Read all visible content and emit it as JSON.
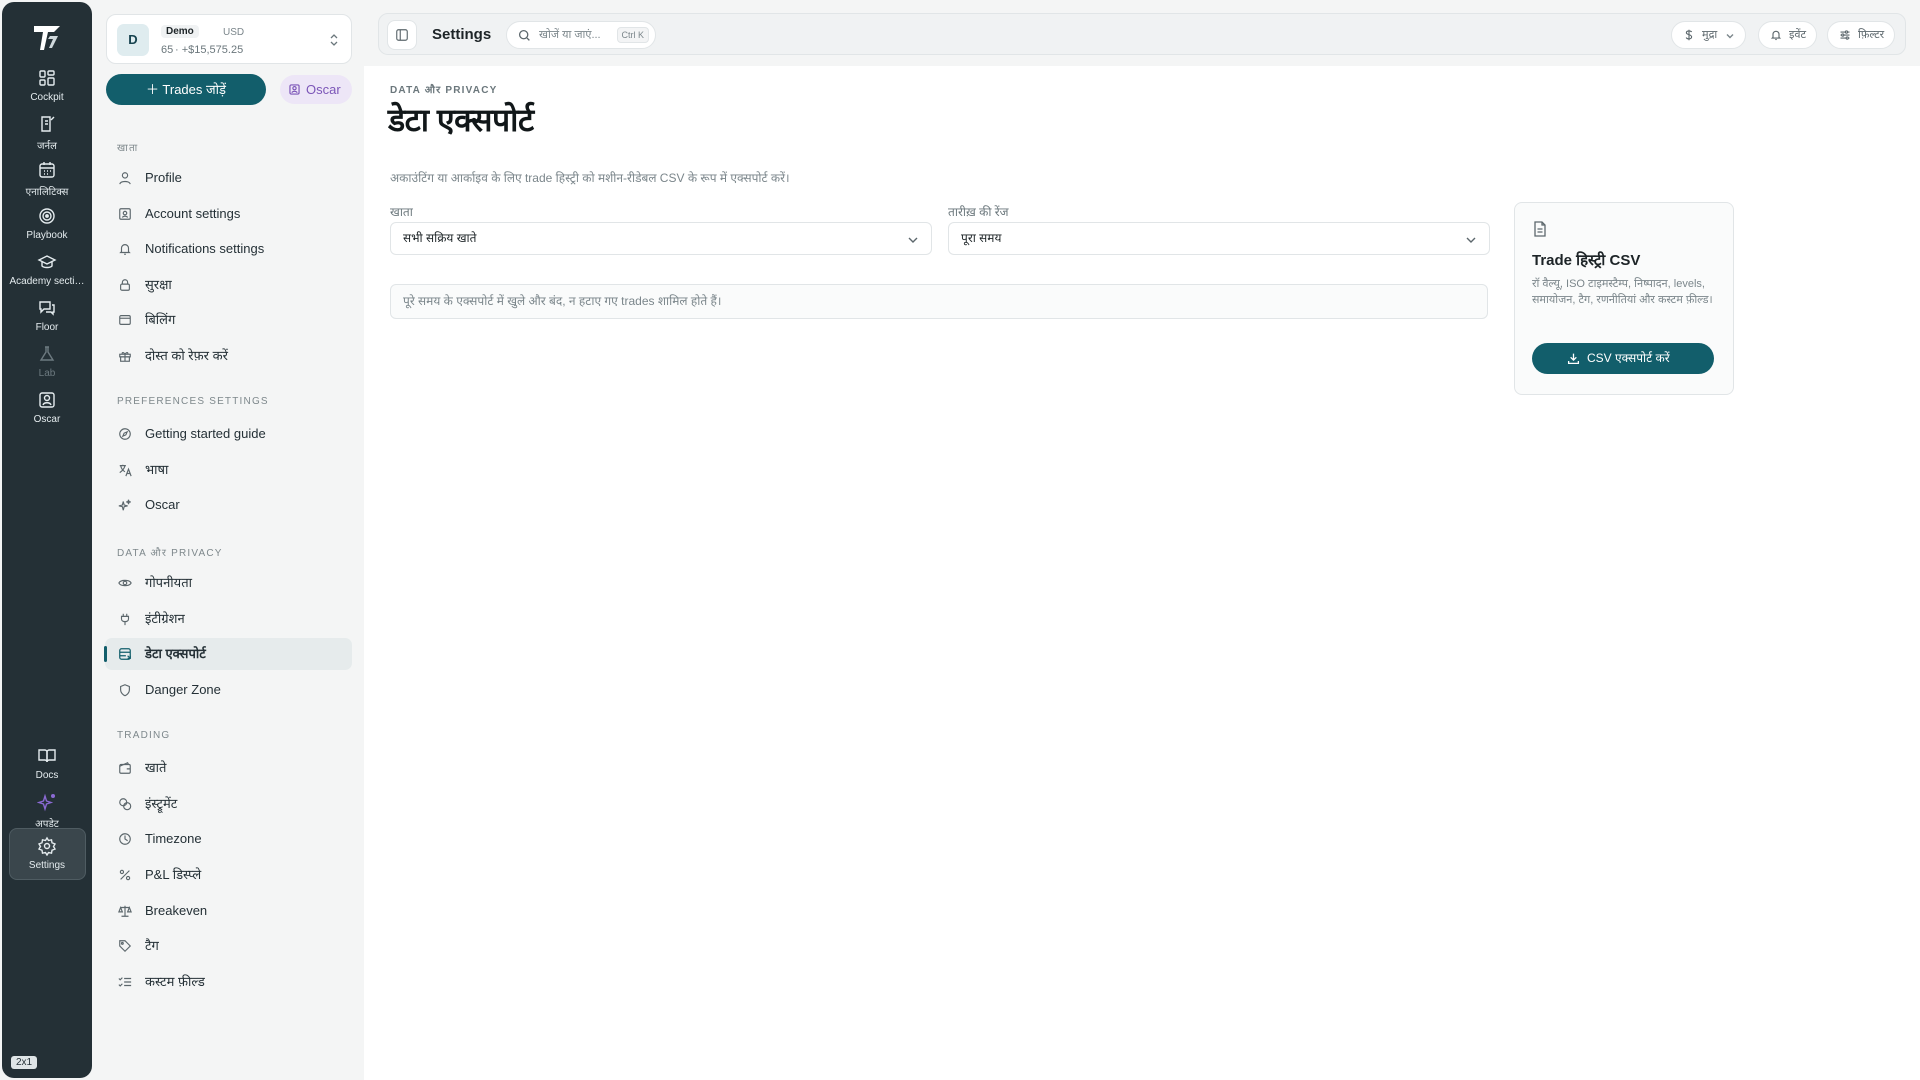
{
  "rail": {
    "items": [
      {
        "label": "Cockpit",
        "icon": "grid-icon"
      },
      {
        "label": "जर्नल",
        "icon": "journal-icon"
      },
      {
        "label": "एनालिटिक्स",
        "icon": "calendar-icon"
      },
      {
        "label": "Playbook",
        "icon": "target-icon"
      },
      {
        "label": "Academy secti…",
        "icon": "graduation-cap-icon"
      },
      {
        "label": "Floor",
        "icon": "chat-icon"
      },
      {
        "label": "Lab",
        "icon": "flask-icon"
      },
      {
        "label": "Oscar",
        "icon": "oscar-icon"
      }
    ],
    "bottom": [
      {
        "label": "Docs",
        "icon": "book-icon"
      },
      {
        "label": "अपडेट",
        "icon": "sparkles-icon"
      },
      {
        "label": "Settings",
        "icon": "gear-icon"
      }
    ],
    "badge": "2x1"
  },
  "account": {
    "avatar": "D",
    "name": "Demo",
    "currency": "USD",
    "count": "65",
    "balance": "· +$15,575.25"
  },
  "add_trades_label": "Trades जोड़ें",
  "oscar_label": "Oscar",
  "sidebar": {
    "sections": [
      {
        "title": "खाता",
        "items": [
          "Profile",
          "Account settings",
          "Notifications settings",
          "सुरक्षा",
          "बिलिंग",
          "दोस्त को रेफ़र करें"
        ]
      },
      {
        "title": "PREFERENCES SETTINGS",
        "items": [
          "Getting started guide",
          "भाषा",
          "Oscar"
        ]
      },
      {
        "title": "DATA और PRIVACY",
        "items": [
          "गोपनीयता",
          "इंटीग्रेशन",
          "डेटा एक्सपोर्ट",
          "Danger Zone"
        ]
      },
      {
        "title": "TRADING",
        "items": [
          "खाते",
          "इंस्ट्रूमेंट",
          "Timezone",
          "P&L डिस्प्ले",
          "Breakeven",
          "टैग",
          "कस्टम फ़ील्ड"
        ]
      }
    ],
    "active": "डेटा एक्सपोर्ट"
  },
  "topbar": {
    "title": "Settings",
    "search_placeholder": "खोजें या जाएं...",
    "shortcut": "Ctrl K",
    "currency_label": "मुद्रा",
    "events_label": "इवेंट",
    "filter_label": "फ़िल्टर"
  },
  "page": {
    "breadcrumb": "DATA और PRIVACY",
    "title": "डेटा एक्सपोर्ट",
    "description": "अकाउंटिंग या आर्काइव के लिए trade हिस्ट्री को मशीन-रीडेबल CSV के रूप में एक्सपोर्ट करें।",
    "account_label": "खाता",
    "account_value": "सभी सक्रिय खाते",
    "date_label": "तारीख़ की रेंज",
    "date_value": "पूरा समय",
    "note": "पूरे समय के एक्सपोर्ट में खुले और बंद, न हटाए गए trades शामिल होते हैं।"
  },
  "card": {
    "title": "Trade हिस्ट्री CSV",
    "description": "रॉ वैल्यू, ISO टाइमस्टैम्प, निष्पादन, levels, समायोजन, टैग, रणनीतियां और कस्टम फ़ील्ड।",
    "button": "CSV एक्सपोर्ट करें"
  },
  "colors": {
    "primary": "#125e6b",
    "rail": "#243036",
    "oscar": "#7c56b8"
  }
}
